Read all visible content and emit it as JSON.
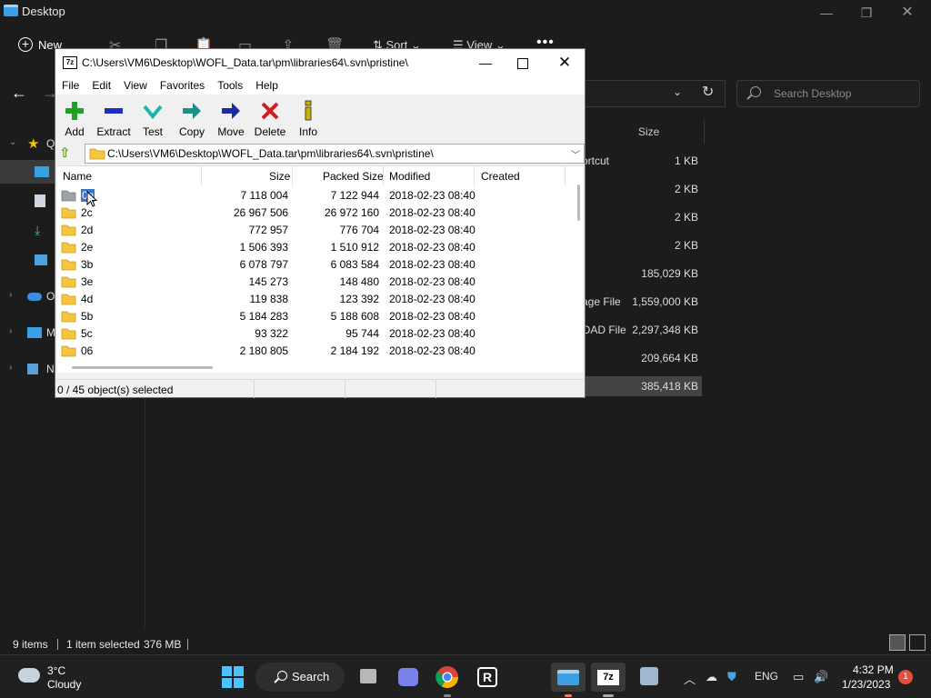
{
  "explorer": {
    "title": "Desktop",
    "new_label": "New",
    "sort_label": "Sort",
    "view_label": "View",
    "search_placeholder": "Search Desktop",
    "sidebar": [
      {
        "label": "Q",
        "icon": "star-icon"
      },
      {
        "label": "",
        "icon": "desktop-icon"
      },
      {
        "label": "",
        "icon": "documents-icon"
      },
      {
        "label": "",
        "icon": "downloads-icon"
      },
      {
        "label": "",
        "icon": "pictures-icon"
      },
      {
        "label": "O",
        "icon": "onedrive-icon"
      },
      {
        "label": "M",
        "icon": "this-pc-icon"
      },
      {
        "label": "N",
        "icon": "network-icon"
      }
    ],
    "col_size": "Size",
    "rows": [
      {
        "type": "ortcut",
        "size": "1 KB"
      },
      {
        "type": "",
        "size": "2 KB"
      },
      {
        "type": "",
        "size": "2 KB"
      },
      {
        "type": "",
        "size": "2 KB"
      },
      {
        "type": "",
        "size": "185,029 KB"
      },
      {
        "type": "age File",
        "size": "1,559,000 KB"
      },
      {
        "type": "OAD File",
        "size": "2,297,348 KB"
      },
      {
        "type": "",
        "size": "209,664 KB"
      },
      {
        "type": "",
        "size": "385,418 KB"
      }
    ],
    "status": {
      "items": "9 items",
      "selected": "1 item selected",
      "size": "376 MB"
    }
  },
  "zip": {
    "title": "C:\\Users\\VM6\\Desktop\\WOFL_Data.tar\\pm\\libraries64\\.svn\\pristine\\",
    "app_icon": "7z",
    "menu": [
      "File",
      "Edit",
      "View",
      "Favorites",
      "Tools",
      "Help"
    ],
    "toolbar": [
      {
        "label": "Add",
        "icon": "add-icon",
        "color": "#1fa02a"
      },
      {
        "label": "Extract",
        "icon": "extract-icon",
        "color": "#1d2fbf"
      },
      {
        "label": "Test",
        "icon": "test-icon",
        "color": "#1bb5b0"
      },
      {
        "label": "Copy",
        "icon": "copy-icon",
        "color": "#1d8f8a"
      },
      {
        "label": "Move",
        "icon": "move-icon",
        "color": "#1f2a9e"
      },
      {
        "label": "Delete",
        "icon": "delete-icon",
        "color": "#d31d1d"
      },
      {
        "label": "Info",
        "icon": "info-icon",
        "color": "#c7b400"
      }
    ],
    "path": "C:\\Users\\VM6\\Desktop\\WOFL_Data.tar\\pm\\libraries64\\.svn\\pristine\\",
    "columns": [
      "Name",
      "Size",
      "Packed Size",
      "Modified",
      "Created"
    ],
    "rows": [
      {
        "name": "0a",
        "size": "7 118 004",
        "packed": "7 122 944",
        "modified": "2018-02-23 08:40"
      },
      {
        "name": "2c",
        "size": "26 967 506",
        "packed": "26 972 160",
        "modified": "2018-02-23 08:40"
      },
      {
        "name": "2d",
        "size": "772 957",
        "packed": "776 704",
        "modified": "2018-02-23 08:40"
      },
      {
        "name": "2e",
        "size": "1 506 393",
        "packed": "1 510 912",
        "modified": "2018-02-23 08:40"
      },
      {
        "name": "3b",
        "size": "6 078 797",
        "packed": "6 083 584",
        "modified": "2018-02-23 08:40"
      },
      {
        "name": "3e",
        "size": "145 273",
        "packed": "148 480",
        "modified": "2018-02-23 08:40"
      },
      {
        "name": "4d",
        "size": "119 838",
        "packed": "123 392",
        "modified": "2018-02-23 08:40"
      },
      {
        "name": "5b",
        "size": "5 184 283",
        "packed": "5 188 608",
        "modified": "2018-02-23 08:40"
      },
      {
        "name": "5c",
        "size": "93 322",
        "packed": "95 744",
        "modified": "2018-02-23 08:40"
      },
      {
        "name": "06",
        "size": "2 180 805",
        "packed": "2 184 192",
        "modified": "2018-02-23 08:40"
      }
    ],
    "status": "0 / 45 object(s) selected"
  },
  "taskbar": {
    "weather_temp": "3°C",
    "weather_cond": "Cloudy",
    "search_label": "Search",
    "lang": "ENG",
    "time": "4:32 PM",
    "date": "1/23/2023",
    "notifications": "1"
  }
}
